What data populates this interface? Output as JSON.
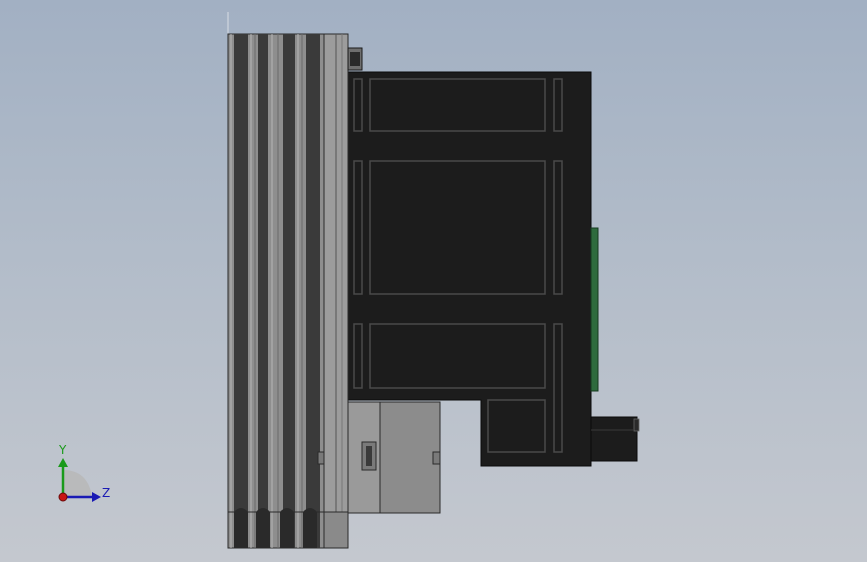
{
  "viewport": {
    "background_top": "#a2b0c3",
    "background_bottom": "#c4c8cf"
  },
  "model": {
    "body_color": "#1c1c1c",
    "heatsink_color": "#8e8e8e",
    "fin_dark_color": "#3a3a3a",
    "terminal_color": "#9a9a9a",
    "pcb_color": "#2e6b3d"
  },
  "triad": {
    "y_label": "Y",
    "z_label": "Z",
    "y_color": "#1a9a1a",
    "z_color": "#1a1ab4",
    "x_color": "#c81414"
  }
}
